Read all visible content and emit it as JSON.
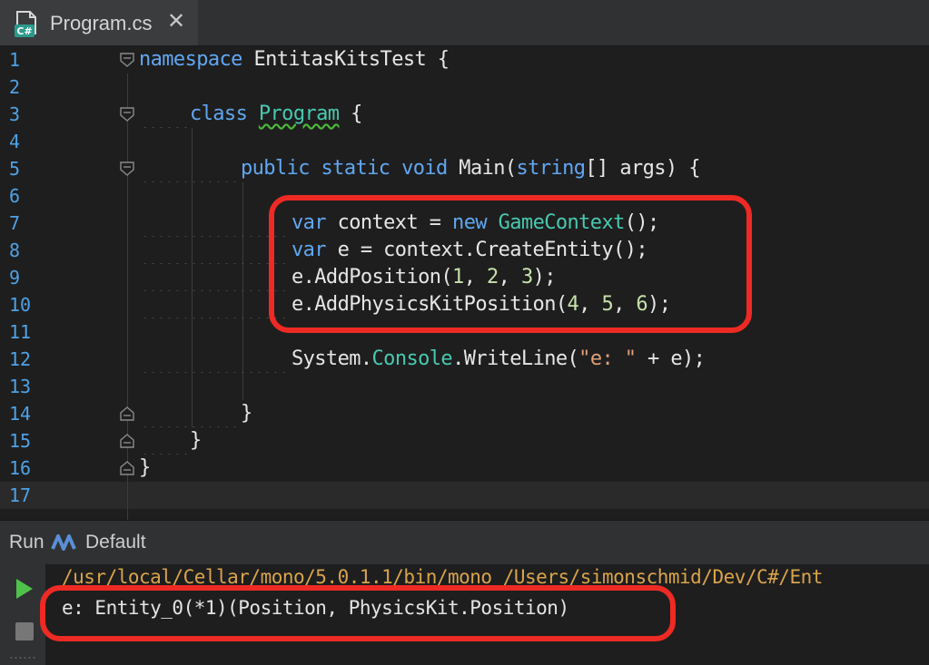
{
  "tab": {
    "title": "Program.cs",
    "close": "✕",
    "file_badge": "C#"
  },
  "editor": {
    "lines": [
      {
        "n": "1"
      },
      {
        "n": "2"
      },
      {
        "n": "3"
      },
      {
        "n": "4"
      },
      {
        "n": "5"
      },
      {
        "n": "6"
      },
      {
        "n": "7"
      },
      {
        "n": "8"
      },
      {
        "n": "9"
      },
      {
        "n": "10"
      },
      {
        "n": "11"
      },
      {
        "n": "12"
      },
      {
        "n": "13"
      },
      {
        "n": "14"
      },
      {
        "n": "15"
      },
      {
        "n": "16"
      },
      {
        "n": "17"
      }
    ],
    "code": {
      "l1": [
        "namespace",
        " EntitasKitsTest {"
      ],
      "l3": [
        "class",
        " ",
        "Program",
        " {"
      ],
      "l5": [
        "public",
        " ",
        "static",
        " ",
        "void",
        " Main(",
        "string",
        "[] args) {"
      ],
      "l7": [
        "var",
        " context = ",
        "new",
        " ",
        "GameContext",
        "();"
      ],
      "l8": [
        "var",
        " e = context.CreateEntity();"
      ],
      "l9": [
        "e.AddPosition(",
        "1",
        ", ",
        "2",
        ", ",
        "3",
        ");"
      ],
      "l10": [
        "e.AddPhysicsKitPosition(",
        "4",
        ", ",
        "5",
        ", ",
        "6",
        ");"
      ],
      "l12": [
        "System.",
        "Console",
        ".WriteLine(",
        "\"e: \"",
        " + e);"
      ],
      "l14": "}",
      "l15": "}",
      "l16": "}"
    }
  },
  "run": {
    "label": "Run",
    "config": "Default",
    "console_path": "/usr/local/Cellar/mono/5.0.1.1/bin/mono /Users/simonschmid/Dev/C#/Ent",
    "console_output": "e: Entity_0(*1)(Position, PhysicsKit.Position)"
  },
  "colors": {
    "keyword": "#61a7f2",
    "type": "#48c9b0",
    "number": "#c6e1ac",
    "string": "#e0a07a",
    "line_number": "#4fa2e6",
    "highlight": "#ee2a24",
    "console_path": "#d9a44b"
  }
}
